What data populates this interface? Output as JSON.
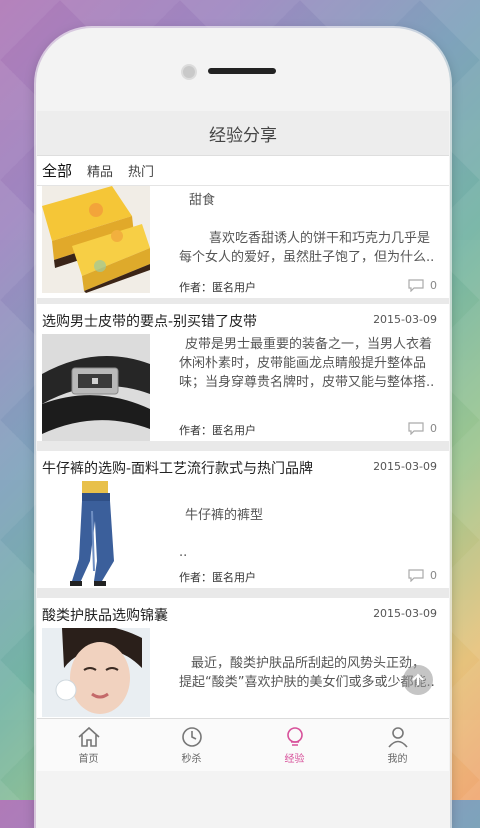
{
  "app": {
    "title": "经验分享"
  },
  "tabs": [
    {
      "label": "全部",
      "active": true
    },
    {
      "label": "精品",
      "active": false
    },
    {
      "label": "热门",
      "active": false
    }
  ],
  "articles": [
    {
      "title": "",
      "date": "",
      "excerpt_1": "甜食",
      "excerpt_2": "喜欢吃香甜诱人的饼干和巧克力几乎是每个女人的爱好，虽然肚子饱了，但为什么..",
      "author": "作者：匿名用户",
      "comments": "0",
      "image": "cake-slice-image"
    },
    {
      "title": "选购男士皮带的要点-别买错了皮带",
      "date": "2015-03-09",
      "excerpt": "皮带是男士最重要的装备之一，当男人衣着休闲朴素时，皮带能画龙点睛般提升整体品味；当身穿尊贵名牌时，皮带又能与整体搭..",
      "author": "作者：匿名用户",
      "comments": "0",
      "image": "leather-belt-image"
    },
    {
      "title": "牛仔裤的选购-面料工艺流行款式与热门品牌",
      "date": "2015-03-09",
      "excerpt_1": "牛仔裤的裤型",
      "excerpt_2": "..",
      "author": "作者：匿名用户",
      "comments": "0",
      "image": "jeans-model-image"
    },
    {
      "title": "酸类护肤品选购锦囊",
      "date": "2015-03-09",
      "excerpt": "最近，酸类护肤品所刮起的风势头正劲，提起“酸类”喜欢护肤的美女们或多或少都能..",
      "image": "skincare-woman-image"
    }
  ],
  "bottom_nav": [
    {
      "label": "首页",
      "icon": "home-icon",
      "active": false
    },
    {
      "label": "秒杀",
      "icon": "flash-sale-icon",
      "active": false
    },
    {
      "label": "经验",
      "icon": "experience-icon",
      "active": true
    },
    {
      "label": "我的",
      "icon": "profile-icon",
      "active": false
    }
  ],
  "colors": {
    "accent": "#d7509a",
    "titlebar": "#ededed"
  }
}
